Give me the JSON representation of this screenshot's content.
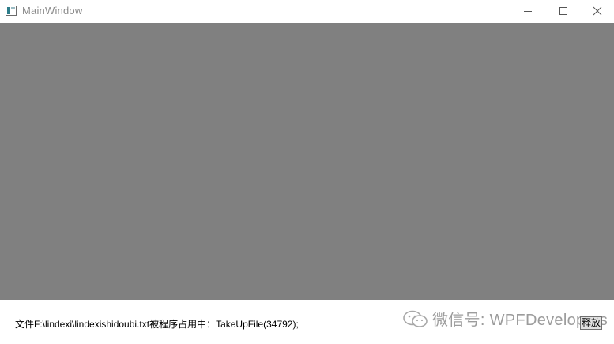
{
  "window": {
    "title": "MainWindow",
    "icon": "wpf-app-icon",
    "controls": {
      "minimize": "minimize-icon",
      "maximize": "maximize-icon",
      "close": "close-icon"
    }
  },
  "content": {
    "background_color": "#808080"
  },
  "status": {
    "message": "文件F:\\lindexi\\lindexishidoubi.txt被程序占用中：TakeUpFile(34792);"
  },
  "watermark": {
    "icon": "wechat-icon",
    "text": "微信号: WPFDevelopers"
  },
  "actions": {
    "release_label": "释放"
  }
}
